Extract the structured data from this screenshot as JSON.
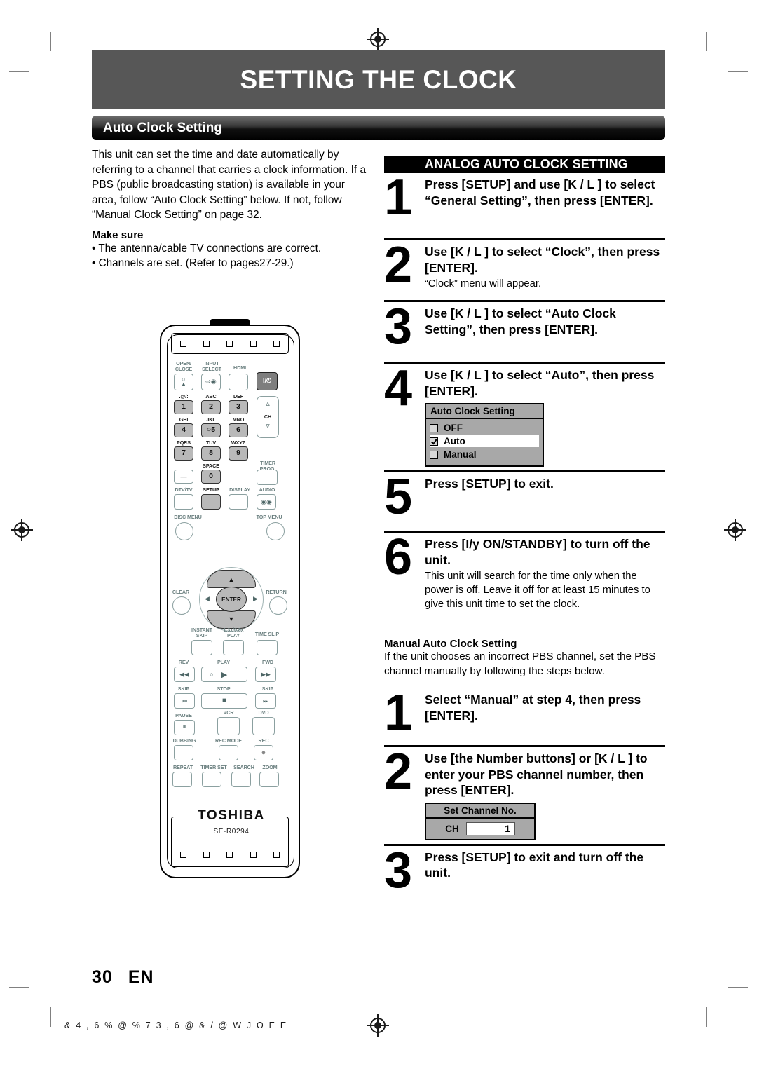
{
  "page": {
    "title": "SETTING THE CLOCK",
    "section": "Auto Clock Setting",
    "number": "30",
    "lang": "EN",
    "footer_code": "& 4 , 6 % @ % 7 3    , 6 @ & / @ W      J O E E"
  },
  "left": {
    "intro": "This unit can set the time and date automatically by referring to a channel that carries a clock information.  If a PBS (public broadcasting station) is available in your area, follow “Auto Clock Setting” below. If not, follow “Manual Clock Setting” on page 32.",
    "make_sure_head": "Make sure",
    "bullets": [
      "• The antenna/cable TV connections are correct.",
      "• Channels are set. (Refer to pages27-29.)"
    ]
  },
  "analog": {
    "heading": "ANALOG AUTO CLOCK SETTING",
    "steps": [
      {
        "num": "1",
        "lead": "Press [SETUP] and use [K / L ] to select “General Setting”, then press [ENTER].",
        "sub": ""
      },
      {
        "num": "2",
        "lead": "Use [K / L ] to select “Clock”, then press [ENTER].",
        "sub": "“Clock” menu will appear."
      },
      {
        "num": "3",
        "lead": "Use [K / L ] to select “Auto Clock Setting”, then press [ENTER].",
        "sub": ""
      },
      {
        "num": "4",
        "lead": "Use [K / L ] to select “Auto”, then press [ENTER].",
        "sub": ""
      },
      {
        "num": "5",
        "lead": "Press [SETUP] to exit.",
        "sub": ""
      },
      {
        "num": "6",
        "lead": "Press [I/y   ON/STANDBY] to turn off the unit.",
        "sub": "This unit will search for the time only when the power is off. Leave it off for at least 15 minutes to give this unit time to set the clock."
      }
    ]
  },
  "osd_auto_clock": {
    "title": "Auto Clock Setting",
    "options": [
      {
        "label": "OFF",
        "checked": false,
        "selected": false
      },
      {
        "label": "Auto",
        "checked": true,
        "selected": true
      },
      {
        "label": "Manual",
        "checked": false,
        "selected": false
      }
    ]
  },
  "manual": {
    "heading": "Manual Auto Clock Setting",
    "intro": "If the unit chooses an incorrect PBS channel, set the PBS channel manually by following the steps below.",
    "steps": [
      {
        "num": "1",
        "lead": "Select “Manual” at step 4, then press [ENTER].",
        "sub": ""
      },
      {
        "num": "2",
        "lead": "Use [the Number buttons] or [K / L ] to enter your PBS channel number, then press [ENTER].",
        "sub": ""
      },
      {
        "num": "3",
        "lead": "Press [SETUP] to exit and turn off the unit.",
        "sub": ""
      }
    ]
  },
  "osd_set_channel": {
    "title": "Set Channel No.",
    "field_label": "CH",
    "field_value": "1"
  },
  "remote": {
    "brand": "TOSHIBA",
    "model": "SE-R0294",
    "labels": {
      "open_close": "OPEN/\nCLOSE",
      "input_select": "INPUT\nSELECT",
      "hdmi": "HDMI",
      "power": "I/⏻",
      "k1_letters": ".@/:",
      "k2_letters": "ABC",
      "k3_letters": "DEF",
      "k4_letters": "GHI",
      "k5_letters": "JKL",
      "k6_letters": "MNO",
      "k7_letters": "PQRS",
      "k8_letters": "TUV",
      "k9_letters": "WXYZ",
      "k0_letters": "SPACE",
      "ch": "CH",
      "timer_prog": "TIMER\nPROG.",
      "dtv_tv": "DTV/TV",
      "setup": "SETUP",
      "display": "DISPLAY",
      "audio": "AUDIO",
      "disc_menu": "DISC MENU",
      "top_menu": "TOP MENU",
      "clear": "CLEAR",
      "return": "RETURN",
      "enter": "ENTER",
      "instant_skip": "INSTANT\nSKIP",
      "play_speed": "1.3x/0.8x\nPLAY",
      "time_slip": "TIME SLIP",
      "rev": "REV",
      "play": "PLAY",
      "fwd": "FWD",
      "skip_back": "SKIP",
      "stop": "STOP",
      "skip_fwd": "SKIP",
      "pause": "PAUSE",
      "vcr": "VCR",
      "dvd": "DVD",
      "dubbing": "DUBBING",
      "rec_mode": "REC MODE",
      "rec": "REC",
      "repeat": "REPEAT",
      "timer_set": "TIMER SET",
      "search": "SEARCH",
      "zoom": "ZOOM"
    },
    "digits": [
      "1",
      "2",
      "3",
      "4",
      "5",
      "6",
      "7",
      "8",
      "9",
      "0"
    ]
  }
}
